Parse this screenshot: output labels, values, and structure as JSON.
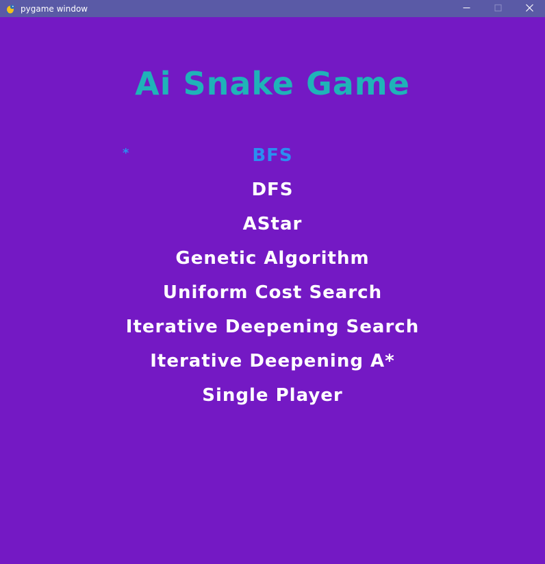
{
  "window": {
    "title": "pygame window",
    "controls": {
      "minimize": "—",
      "maximize": "☐",
      "close": "✕"
    }
  },
  "game": {
    "title": "Ai Snake Game",
    "cursor": "*",
    "menu": [
      {
        "label": "BFS",
        "selected": true
      },
      {
        "label": "DFS",
        "selected": false
      },
      {
        "label": "AStar",
        "selected": false
      },
      {
        "label": "Genetic Algorithm",
        "selected": false
      },
      {
        "label": "Uniform Cost Search",
        "selected": false
      },
      {
        "label": "Iterative Deepening Search",
        "selected": false
      },
      {
        "label": "Iterative Deepening A*",
        "selected": false
      },
      {
        "label": "Single Player",
        "selected": false
      }
    ]
  },
  "colors": {
    "background": "#7419c4",
    "titlebar": "#5a5aa6",
    "title_text": "#1fb3b8",
    "selected_item": "#2a8ff0",
    "menu_item": "#ffffff"
  },
  "icons": {
    "app": "pygame-snake-icon"
  }
}
